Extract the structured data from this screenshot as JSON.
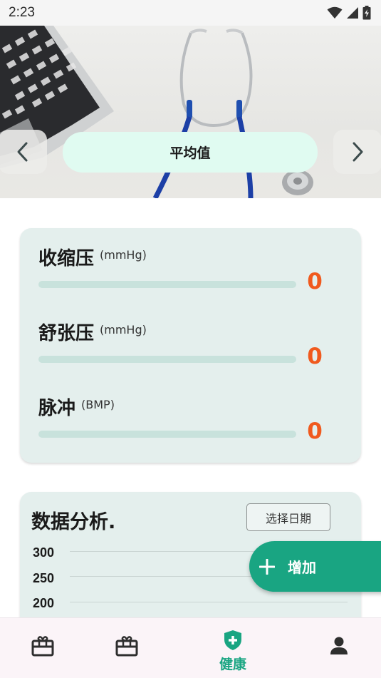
{
  "status_bar": {
    "time": "2:23",
    "icons": [
      "wifi-icon",
      "cell-signal-icon",
      "battery-charging-icon"
    ]
  },
  "hero": {
    "title": "平均值",
    "prev_icon": "chevron-left-icon",
    "next_icon": "chevron-right-icon"
  },
  "vitals": [
    {
      "name": "收缩压",
      "unit": "(mmHg)",
      "value": "0",
      "progress": 0
    },
    {
      "name": "舒张压",
      "unit": "(mmHg)",
      "value": "0",
      "progress": 0
    },
    {
      "name": "脉冲",
      "unit": "(BMP)",
      "value": "0",
      "progress": 0
    }
  ],
  "analysis": {
    "title": "数据分析.",
    "date_button": "选择日期",
    "y_axis_labels": [
      "300",
      "250",
      "200"
    ]
  },
  "fab": {
    "label": "增加",
    "icon": "plus-icon"
  },
  "bottom_nav": {
    "items": [
      {
        "icon": "gift-box-icon",
        "label": "",
        "active": false
      },
      {
        "icon": "gift-box-icon",
        "label": "",
        "active": false
      },
      {
        "icon": "shield-plus-icon",
        "label": "健康",
        "active": true
      },
      {
        "icon": "person-icon",
        "label": "",
        "active": false
      }
    ]
  },
  "colors": {
    "accent": "#19a582",
    "value": "#f05a1e",
    "card_bg": "#e4efed",
    "pill_bg": "#e0fbf1",
    "nav_bg": "#fbf4f8"
  }
}
